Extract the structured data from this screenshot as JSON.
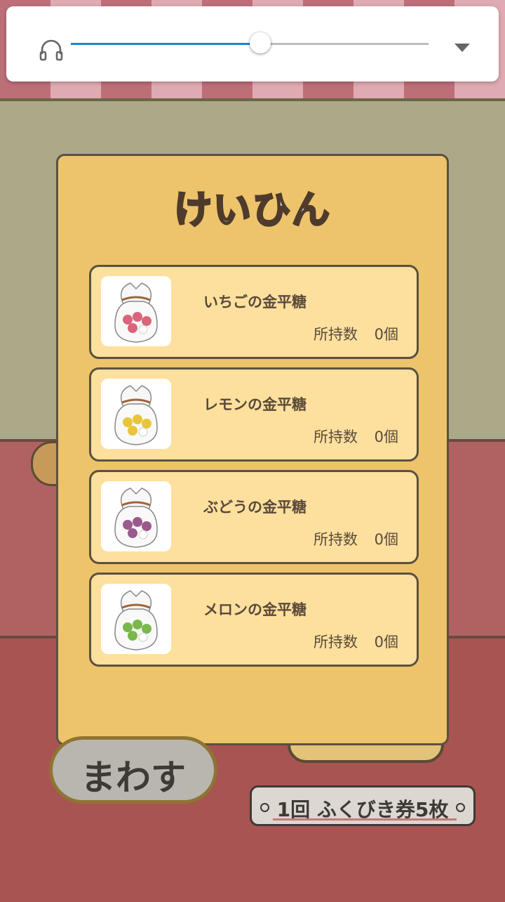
{
  "audio_bar": {
    "icon": "headphones-icon",
    "volume_percent": 53,
    "dropdown_icon": "dropdown-icon",
    "accent_color": "#1e88c7"
  },
  "panel": {
    "title": "けいひん",
    "items": [
      {
        "name": "いちごの金平糖",
        "count_label": "所持数",
        "count_value": "0個",
        "candy_color": "#d9657a"
      },
      {
        "name": "レモンの金平糖",
        "count_label": "所持数",
        "count_value": "0個",
        "candy_color": "#e8c53a"
      },
      {
        "name": "ぶどうの金平糖",
        "count_label": "所持数",
        "count_value": "0個",
        "candy_color": "#9a5a8e"
      },
      {
        "name": "メロンの金平糖",
        "count_label": "所持数",
        "count_value": "0個",
        "candy_color": "#79b84c"
      }
    ]
  },
  "controls": {
    "spin_label": "まわす",
    "ticket_text": "1回 ふくびき券5枚"
  }
}
